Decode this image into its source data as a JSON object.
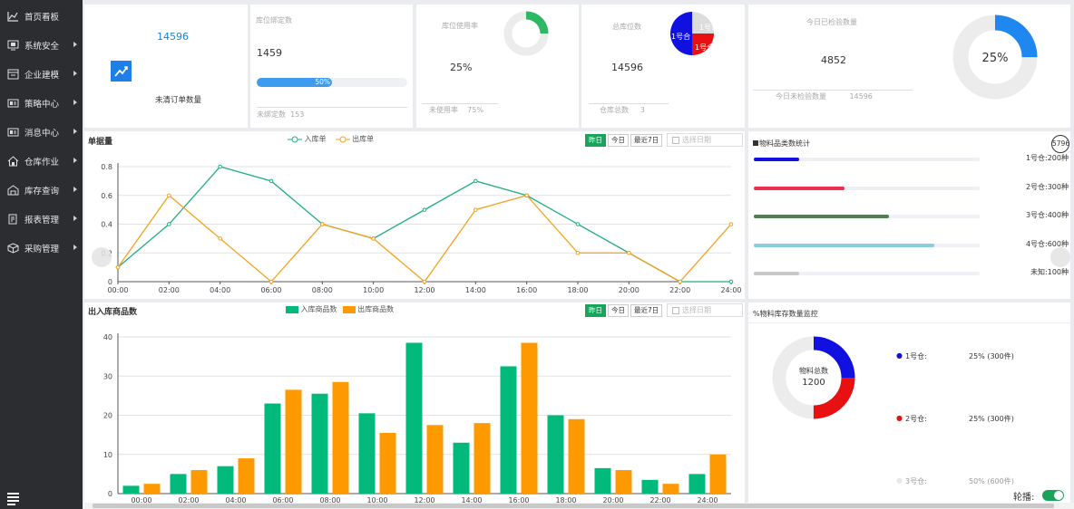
{
  "sidebar": {
    "items": [
      {
        "label": "首页看板",
        "icon": "line-chart-icon"
      },
      {
        "label": "系统安全",
        "icon": "monitor-icon"
      },
      {
        "label": "企业建模",
        "icon": "window-icon"
      },
      {
        "label": "策略中心",
        "icon": "id-card-icon"
      },
      {
        "label": "消息中心",
        "icon": "message-card-icon"
      },
      {
        "label": "仓库作业",
        "icon": "house-icon"
      },
      {
        "label": "库存查询",
        "icon": "warehouse-icon"
      },
      {
        "label": "报表管理",
        "icon": "report-icon"
      },
      {
        "label": "采购管理",
        "icon": "cube-icon"
      }
    ]
  },
  "stats": {
    "orders": {
      "value": "14596",
      "label": "未清订单数量"
    },
    "bind": {
      "title": "库位绑定数",
      "value": "1459",
      "progress_label": "50%",
      "progress": 50,
      "sub_label": "未绑定数",
      "sub_value": "153"
    },
    "usage": {
      "title": "库位使用率",
      "value": "25%",
      "sub_label": "未使用率",
      "sub_value": "75%",
      "ring_percent": 25
    },
    "total": {
      "title": "总库位数",
      "value": "14596",
      "sub_label": "仓库总数",
      "sub_value": "3",
      "pie_labels": [
        "1号合",
        "1号合",
        "1号合"
      ]
    },
    "inspect": {
      "title": "今日已检验数量",
      "value": "4852",
      "sub_label": "今日未检验数量",
      "sub_value": "14596",
      "ring_label": "25%",
      "ring_percent": 25
    }
  },
  "filters": {
    "yesterday": "昨日",
    "today": "今日",
    "last7": "最近7日",
    "date_placeholder": "选择日期"
  },
  "line_panel": {
    "title": "单据量"
  },
  "bar_panel": {
    "title": "出入库商品数"
  },
  "category_panel": {
    "title": "物料品类数统计",
    "badge": "5796",
    "rows": [
      {
        "label": "1号仓:",
        "value": "200种",
        "fraction": 0.2,
        "color": "#1010e0"
      },
      {
        "label": "2号仓:",
        "value": "300种",
        "fraction": 0.4,
        "color": "#e8304e"
      },
      {
        "label": "3号仓:",
        "value": "400种",
        "fraction": 0.6,
        "color": "#4e7f4e"
      },
      {
        "label": "4号仓:",
        "value": "600种",
        "fraction": 0.8,
        "color": "#8ecbe0"
      },
      {
        "label": "未知:",
        "value": "100种",
        "fraction": 0.2,
        "color": "#c8c8c8"
      }
    ]
  },
  "stock_panel": {
    "title": "物料库存数量监控",
    "center_label": "物料总数",
    "center_value": "1200",
    "legend": [
      {
        "name": "1号仓:",
        "value": "25% (300件)",
        "color": "#1010e0"
      },
      {
        "name": "2号仓:",
        "value": "25% (300件)",
        "color": "#e81010"
      },
      {
        "name": "3号仓:",
        "value": "50% (600件)",
        "color": "#e8e8e8"
      }
    ],
    "carousel_label": "轮播:"
  },
  "chart_data": [
    {
      "type": "line",
      "title": "单据量",
      "x": [
        "00:00",
        "02:00",
        "04:00",
        "06:00",
        "08:00",
        "10:00",
        "12:00",
        "14:00",
        "16:00",
        "18:00",
        "20:00",
        "22:00",
        "24:00"
      ],
      "ylim": [
        0,
        0.8
      ],
      "yticks": [
        0,
        0.2,
        0.4,
        0.6,
        0.8
      ],
      "grid": true,
      "legend": "top-center",
      "series": [
        {
          "name": "入库单",
          "color": "#1fae7f",
          "values": [
            0.1,
            0.4,
            0.8,
            0.7,
            0.4,
            0.3,
            0.5,
            0.7,
            0.6,
            0.4,
            0.2,
            0,
            0
          ]
        },
        {
          "name": "出库单",
          "color": "#f5a21e",
          "values": [
            0.1,
            0.6,
            0.3,
            0,
            0.4,
            0.3,
            0,
            0.5,
            0.6,
            0.2,
            0.2,
            0,
            0.4
          ]
        }
      ]
    },
    {
      "type": "bar",
      "title": "出入库商品数",
      "categories": [
        "00:00",
        "02:00",
        "04:00",
        "06:00",
        "08:00",
        "10:00",
        "12:00",
        "14:00",
        "16:00",
        "18:00",
        "20:00",
        "22:00",
        "24:00"
      ],
      "ylim": [
        0,
        40
      ],
      "yticks": [
        0,
        10,
        20,
        30,
        40
      ],
      "grid": true,
      "legend": "top-center",
      "series": [
        {
          "name": "入库商品数",
          "color": "#00b97a",
          "values": [
            2,
            5,
            7,
            23,
            25.5,
            20.5,
            38.5,
            13,
            32.5,
            20,
            6.5,
            3.5,
            5
          ]
        },
        {
          "name": "出库商品数",
          "color": "#ff9900",
          "values": [
            2.5,
            6,
            9,
            26.5,
            28.5,
            15.5,
            17.5,
            18,
            38.5,
            19,
            6,
            2.5,
            10
          ]
        }
      ]
    }
  ]
}
